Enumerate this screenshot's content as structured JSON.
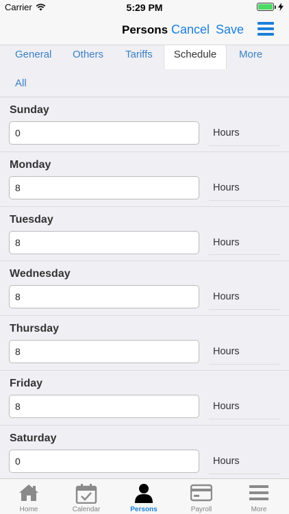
{
  "status_bar": {
    "carrier": "Carrier",
    "time": "5:29 PM"
  },
  "nav": {
    "title": "Persons",
    "cancel": "Cancel",
    "save": "Save"
  },
  "tabs": [
    {
      "label": "General"
    },
    {
      "label": "Others"
    },
    {
      "label": "Tariffs"
    },
    {
      "label": "Schedule",
      "active": true
    },
    {
      "label": "More"
    },
    {
      "label": "All"
    }
  ],
  "schedule": {
    "unit": "Hours",
    "days": [
      {
        "label": "Sunday",
        "value": "0"
      },
      {
        "label": "Monday",
        "value": "8"
      },
      {
        "label": "Tuesday",
        "value": "8"
      },
      {
        "label": "Wednesday",
        "value": "8"
      },
      {
        "label": "Thursday",
        "value": "8"
      },
      {
        "label": "Friday",
        "value": "8"
      },
      {
        "label": "Saturday",
        "value": "0"
      }
    ]
  },
  "tab_bar": {
    "items": [
      {
        "label": "Home",
        "icon": "home-icon"
      },
      {
        "label": "Calendar",
        "icon": "calendar-icon"
      },
      {
        "label": "Persons",
        "icon": "person-icon",
        "active": true
      },
      {
        "label": "Payroll",
        "icon": "credit-card-icon"
      },
      {
        "label": "More",
        "icon": "menu-icon"
      }
    ]
  },
  "colors": {
    "accent": "#1a7fd9",
    "tab_text": "#3a80c4",
    "battery": "#4cd964"
  }
}
